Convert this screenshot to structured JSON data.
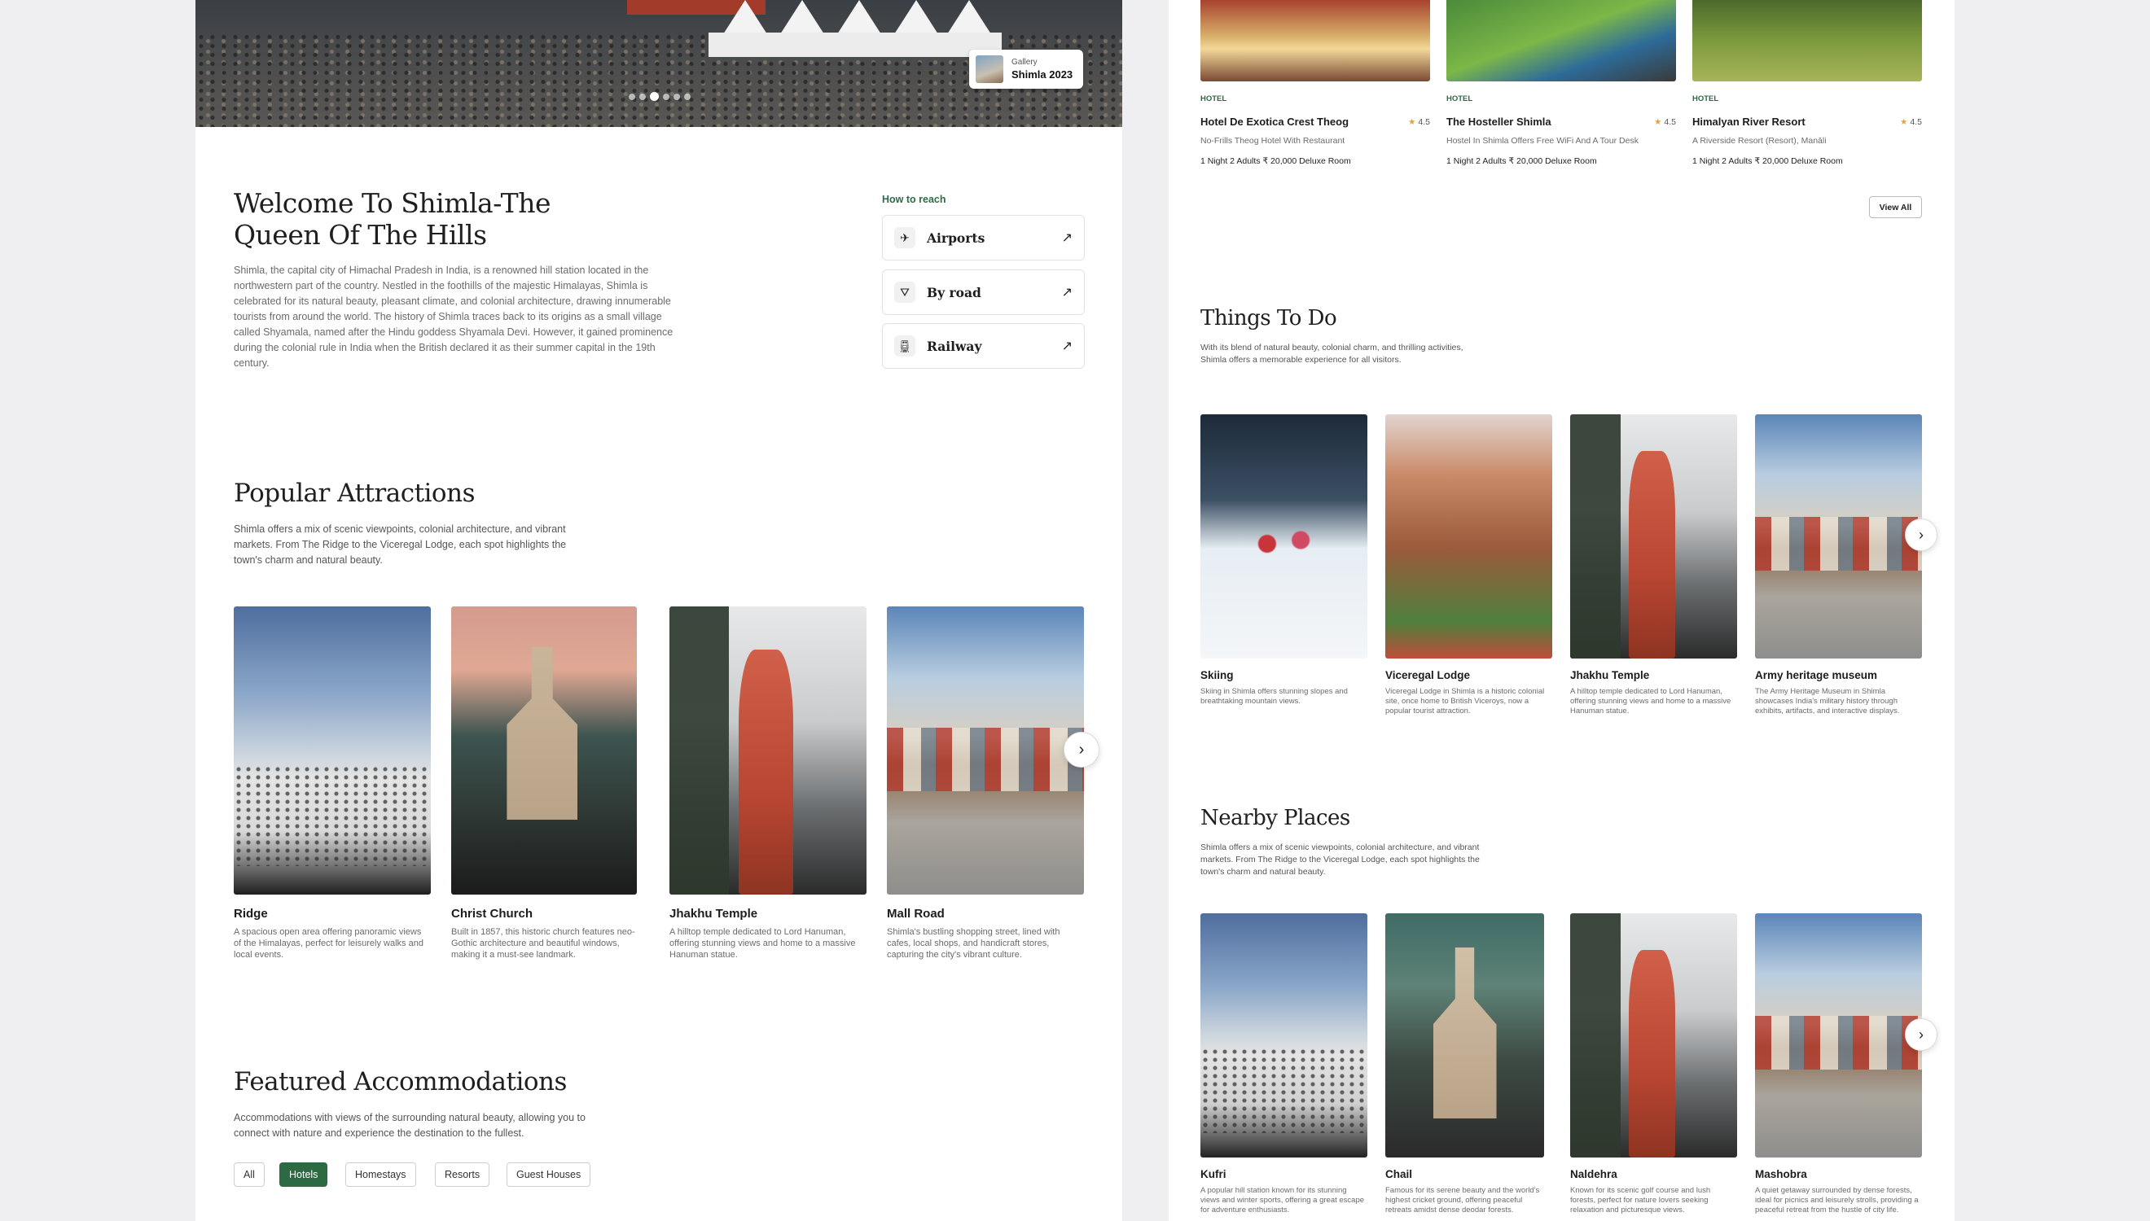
{
  "hero": {
    "gallery_label": "Gallery",
    "gallery_title": "Shimla 2023",
    "dots_count": 6,
    "active_dot": 2
  },
  "welcome": {
    "title": "Welcome To Shimla-The Queen Of The Hills",
    "description": "Shimla, the capital city of Himachal Pradesh in India, is a renowned hill station located in the northwestern part of the country. Nestled in the foothills of the majestic Himalayas, Shimla is celebrated for its natural beauty, pleasant climate, and colonial architecture, drawing innumerable tourists from around the world. The history of Shimla traces back to its origins as a small village called Shyamala, named after the Hindu goddess Shyamala Devi. However, it gained prominence during the colonial rule in India when the British declared it as their summer capital in the 19th century."
  },
  "how_to_reach": {
    "label": "How to reach",
    "options": [
      {
        "label": "Airports",
        "icon": "plane-icon"
      },
      {
        "label": "By road",
        "icon": "road-icon"
      },
      {
        "label": "Railway",
        "icon": "train-icon"
      }
    ]
  },
  "popular": {
    "title": "Popular Attractions",
    "description": "Shimla offers a mix of scenic viewpoints, colonial architecture, and vibrant markets. From The Ridge to the Viceregal Lodge, each spot highlights the town's charm and natural beauty.",
    "items": [
      {
        "name": "Ridge",
        "desc": "A spacious open area offering panoramic views of the Himalayas, perfect for leisurely walks and local events."
      },
      {
        "name": "Christ Church",
        "desc": "Built in 1857, this historic church features neo-Gothic architecture and beautiful windows, making it a must-see landmark."
      },
      {
        "name": "Jhakhu Temple",
        "desc": "A hilltop temple dedicated to Lord Hanuman, offering stunning views and home to a massive Hanuman statue."
      },
      {
        "name": "Mall Road",
        "desc": "Shimla's bustling shopping street, lined with cafes, local shops, and handicraft stores, capturing the city's vibrant culture."
      }
    ]
  },
  "featured": {
    "title": "Featured Accommodations",
    "description": "Accommodations with views of the surrounding natural beauty, allowing you to connect with nature and experience the destination to the fullest.",
    "filters": [
      "All",
      "Hotels",
      "Homestays",
      "Resorts",
      "Guest Houses"
    ],
    "active_filter": "Hotels"
  },
  "hotels": {
    "items": [
      {
        "tag": "HOTEL",
        "name": "Hotel De Exotica Crest Theog",
        "rating": "4.5",
        "sub": "No-Frills Theog Hotel With Restaurant",
        "price": "1 Night 2 Adults ₹ 20,000 Deluxe Room"
      },
      {
        "tag": "HOTEL",
        "name": "The Hosteller Shimla",
        "rating": "4.5",
        "sub": "Hostel In Shimla Offers Free WiFi And A Tour Desk",
        "price": "1 Night 2 Adults ₹ 20,000 Deluxe Room"
      },
      {
        "tag": "HOTEL",
        "name": "Himalyan River Resort",
        "rating": "4.5",
        "sub": "A Riverside Resort (Resort), Manāli",
        "price": "1 Night 2 Adults ₹ 20,000 Deluxe Room"
      }
    ],
    "view_all": "View All"
  },
  "things": {
    "title": "Things To Do",
    "description": "With its blend of natural beauty, colonial charm, and thrilling activities, Shimla offers a memorable experience for all visitors.",
    "items": [
      {
        "name": "Skiing",
        "desc": "Skiing in Shimla offers stunning slopes and breathtaking mountain views."
      },
      {
        "name": "Viceregal Lodge",
        "desc": "Viceregal Lodge in Shimla is a historic colonial site, once home to British Viceroys, now a popular tourist attraction."
      },
      {
        "name": "Jhakhu Temple",
        "desc": "A hilltop temple dedicated to Lord Hanuman, offering stunning views and home to a massive Hanuman statue."
      },
      {
        "name": "Army heritage museum",
        "desc": "The Army Heritage Museum in Shimla showcases India's military history through exhibits, artifacts, and interactive displays."
      }
    ]
  },
  "nearby": {
    "title": "Nearby Places",
    "description": "Shimla offers a mix of scenic viewpoints, colonial architecture, and vibrant markets. From The Ridge to the Viceregal Lodge, each spot highlights the town's charm and natural beauty.",
    "items": [
      {
        "name": "Kufri",
        "desc": "A popular hill station known for its stunning views and winter sports, offering a great escape for adventure enthusiasts."
      },
      {
        "name": "Chail",
        "desc": "Famous for its serene beauty and the world's highest cricket ground, offering peaceful retreats amidst dense deodar forests."
      },
      {
        "name": "Naldehra",
        "desc": "Known for its scenic golf course and lush forests, perfect for nature lovers seeking relaxation and picturesque views."
      },
      {
        "name": "Mashobra",
        "desc": "A quiet getaway surrounded by dense forests, ideal for picnics and leisurely strolls, providing a peaceful retreat from the hustle of city life."
      }
    ]
  }
}
